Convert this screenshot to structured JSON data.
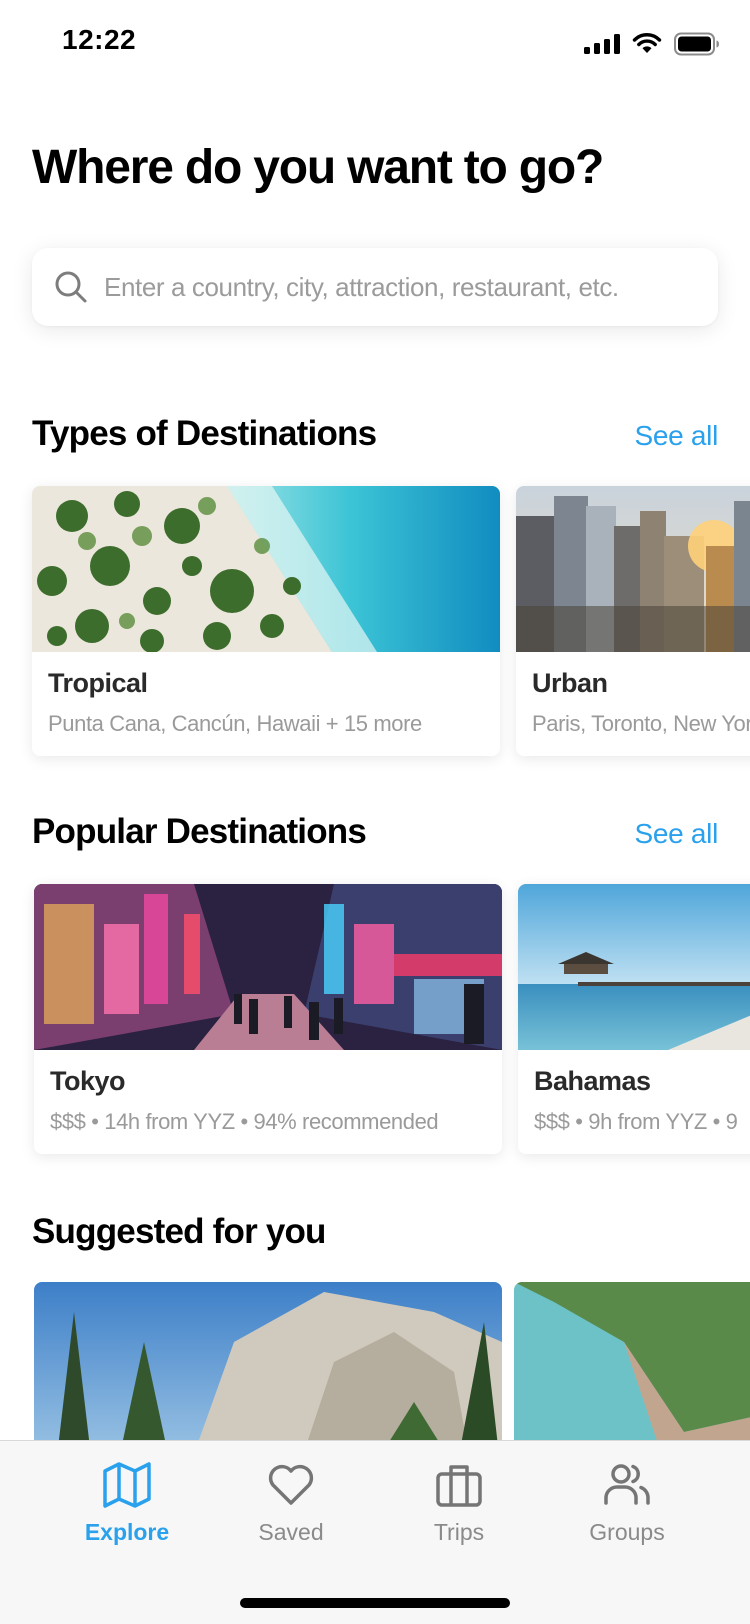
{
  "status": {
    "time": "12:22",
    "icons": [
      "cellular-signal-icon",
      "wifi-icon",
      "battery-icon"
    ]
  },
  "title": "Where do you want to go?",
  "search": {
    "placeholder": "Enter a country, city, attraction, restaurant, etc.",
    "value": "",
    "icon": "search-icon"
  },
  "types": {
    "title": "Types of Destinations",
    "see_all": "See all",
    "cards": [
      {
        "title": "Tropical",
        "subtitle": "Punta Cana, Cancún, Hawaii + 15 more"
      },
      {
        "title": "Urban",
        "subtitle": "Paris, Toronto,  New York"
      }
    ]
  },
  "popular": {
    "title": "Popular Destinations",
    "see_all": "See all",
    "cards": [
      {
        "title": "Tokyo",
        "subtitle": "$$$ • 14h from YYZ • 94%  recommended"
      },
      {
        "title": "Bahamas",
        "subtitle": "$$$ • 9h from YYZ • 9"
      }
    ]
  },
  "suggested": {
    "title": "Suggested for you"
  },
  "tabs": [
    {
      "label": "Explore",
      "icon": "map-icon",
      "active": true
    },
    {
      "label": "Saved",
      "icon": "heart-icon",
      "active": false
    },
    {
      "label": "Trips",
      "icon": "briefcase-icon",
      "active": false
    },
    {
      "label": "Groups",
      "icon": "users-icon",
      "active": false
    }
  ],
  "colors": {
    "accent": "#2aa1ec",
    "inactive": "#8a8a8a",
    "title": "#000000",
    "subtitle": "#9a9a9a"
  }
}
